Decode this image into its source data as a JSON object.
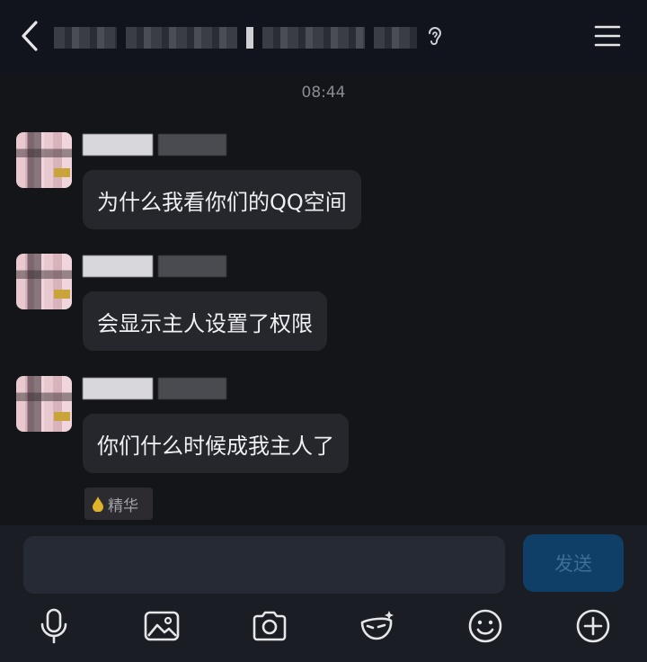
{
  "header": {
    "title": "▪▪▪▪ ▪▪▪▪▪ ▪ ▪▪▪▪▪▪▪▪",
    "icons": {
      "back": "chevron-left-icon",
      "listen": "ear-icon",
      "menu": "hamburger-menu-icon"
    }
  },
  "chat": {
    "timestamp": "08:44",
    "messages": [
      {
        "text": "为什么我看你们的QQ空间"
      },
      {
        "text": "会显示主人设置了权限"
      },
      {
        "text": "你们什么时候成我主人了"
      }
    ],
    "featured_tag": "精华"
  },
  "composer": {
    "input_value": "",
    "send_label": "发送"
  },
  "toolbar": {
    "items": [
      "microphone-icon",
      "image-icon",
      "camera-icon",
      "mask-effect-icon",
      "emoji-icon",
      "plus-icon"
    ]
  },
  "colors": {
    "background": "#141518",
    "bubble": "#26272c",
    "send_button": "#0f3e66",
    "send_text": "#3b6f98"
  }
}
